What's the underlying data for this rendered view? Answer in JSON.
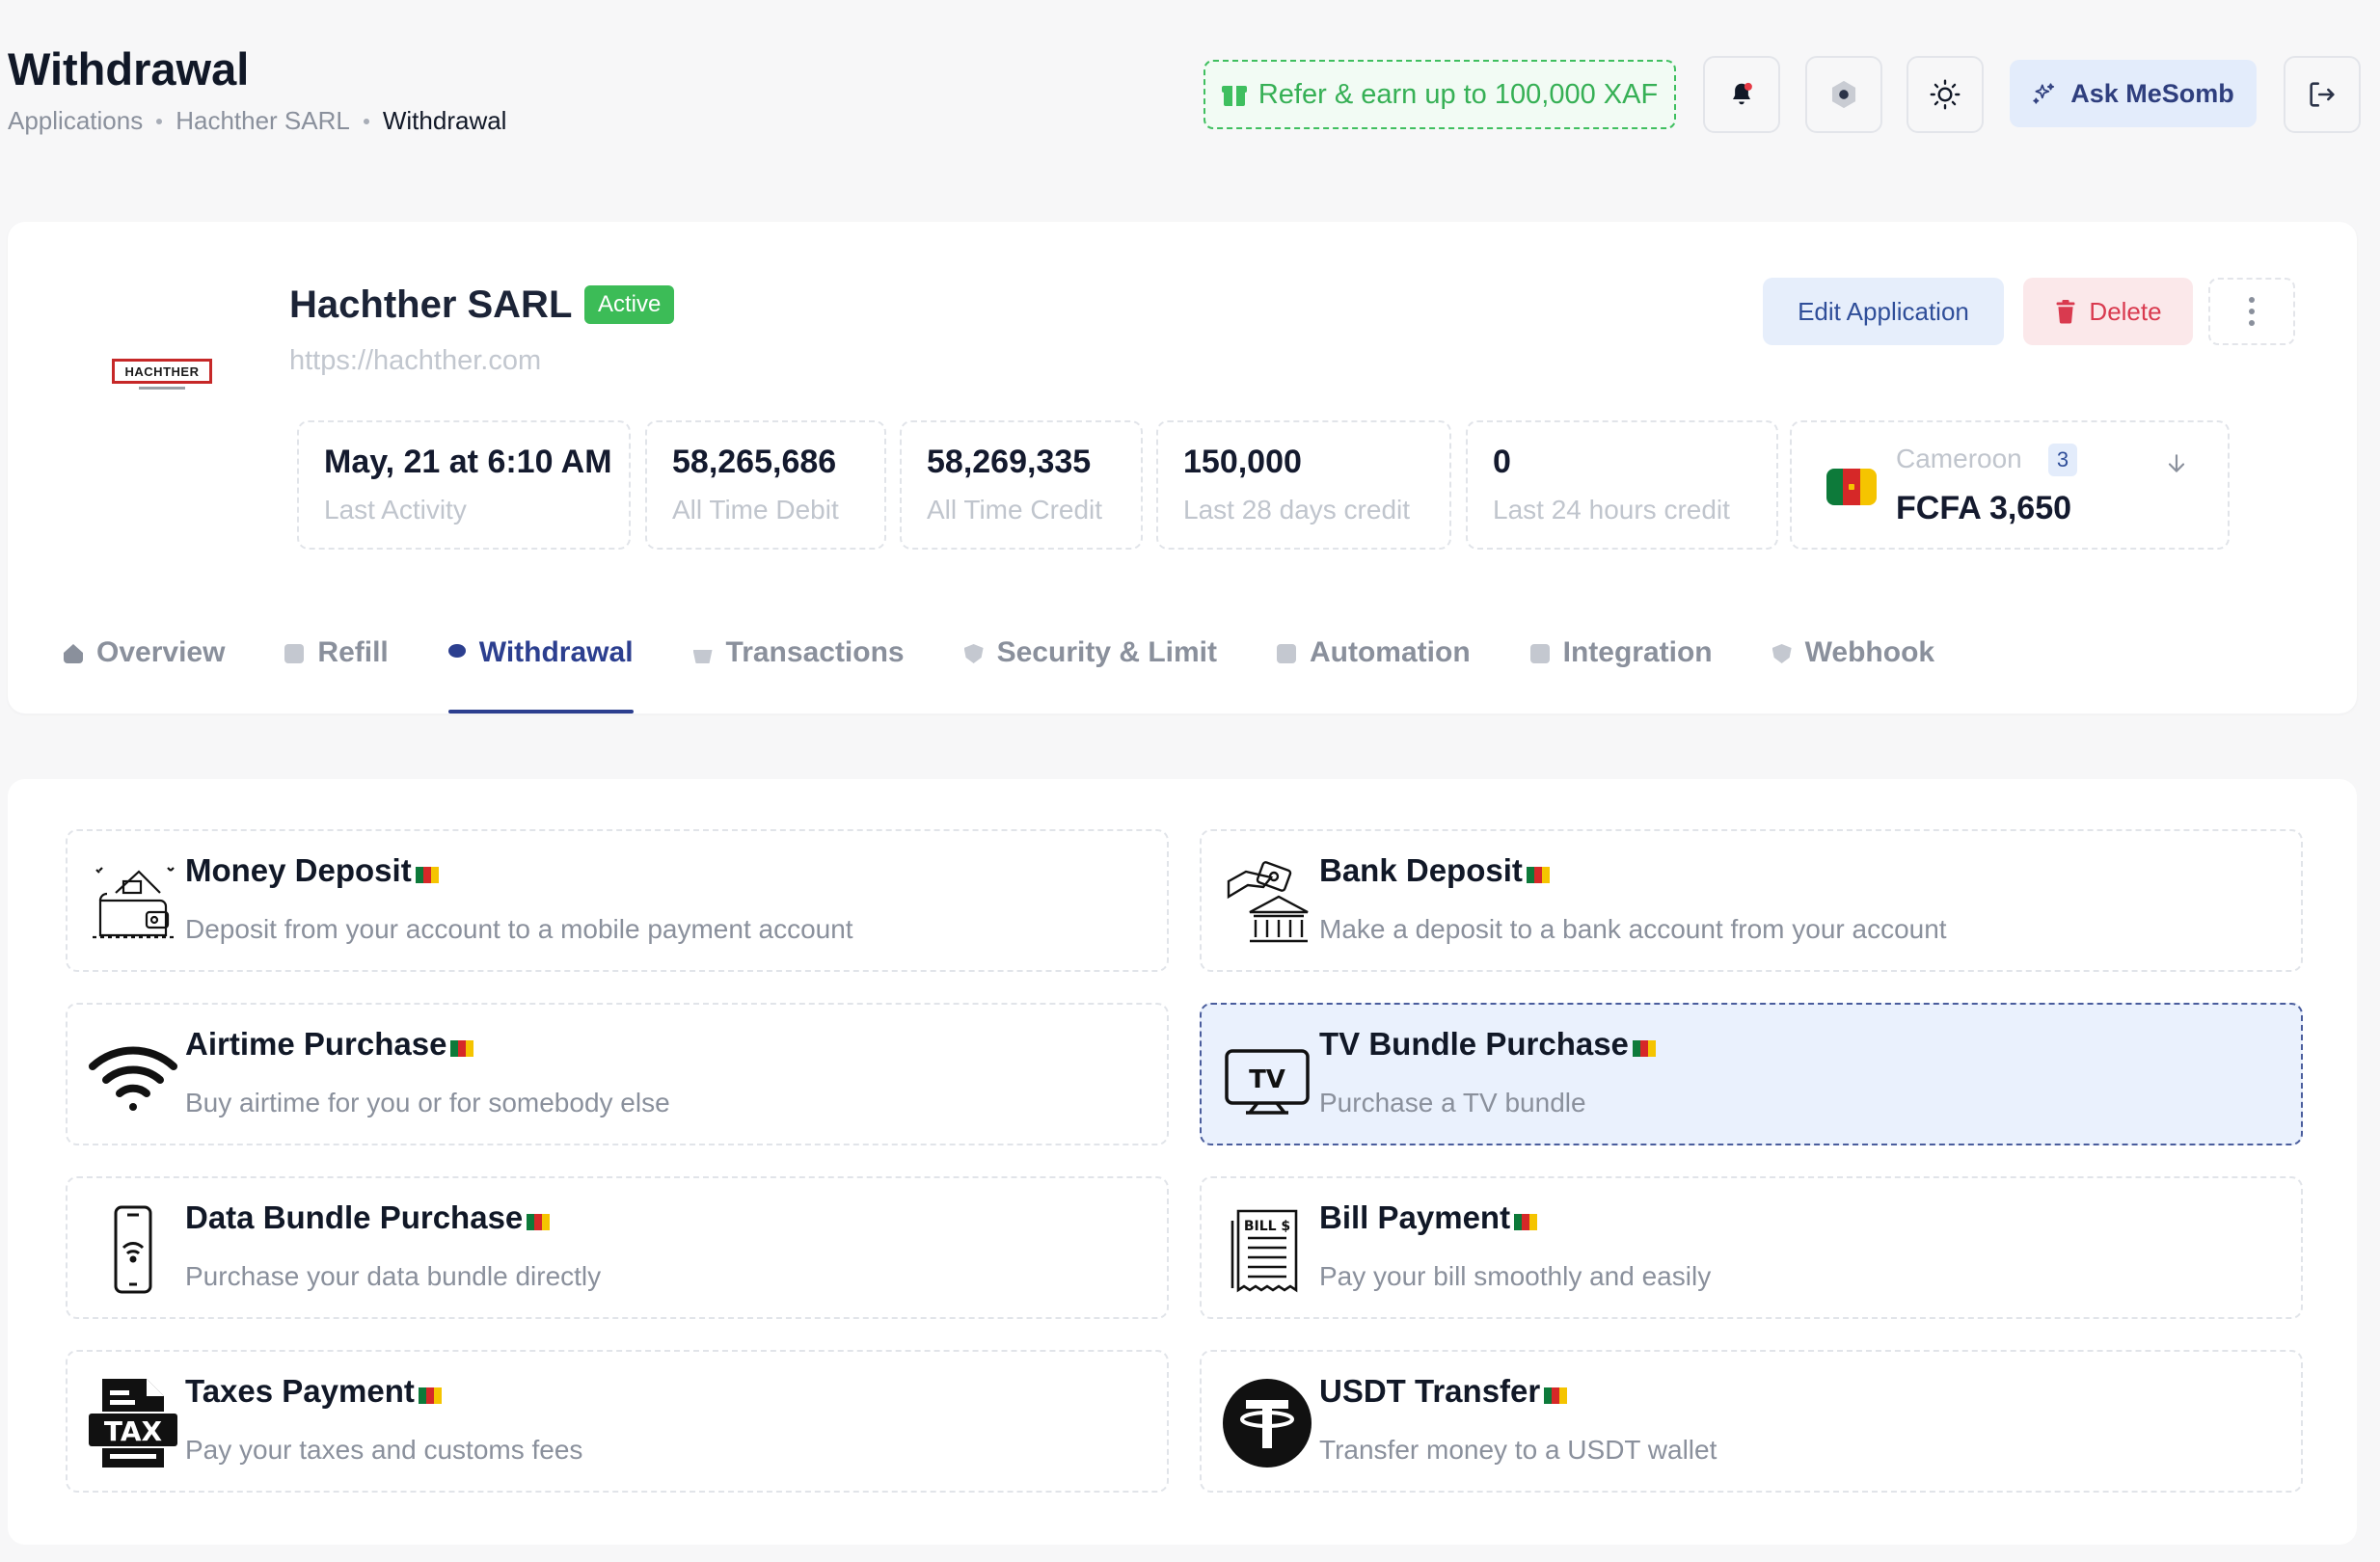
{
  "header": {
    "title": "Withdrawal",
    "breadcrumb": [
      "Applications",
      "Hachther SARL",
      "Withdrawal"
    ],
    "refer_label": "Refer & earn up to 100,000 XAF",
    "ask_label": "Ask MeSomb",
    "icons": [
      "bell-icon",
      "hexagon-icon",
      "sun-icon",
      "logout-icon"
    ]
  },
  "app": {
    "logo_text": "HACHTHER",
    "name": "Hachther SARL",
    "status": "Active",
    "url": "https://hachther.com",
    "edit_label": "Edit Application",
    "delete_label": "Delete",
    "stats": [
      {
        "value": "May, 21 at 6:10 AM",
        "label": "Last Activity"
      },
      {
        "value": "58,265,686",
        "label": "All Time Debit"
      },
      {
        "value": "58,269,335",
        "label": "All Time Credit"
      },
      {
        "value": "150,000",
        "label": "Last 28 days credit"
      },
      {
        "value": "0",
        "label": "Last 24 hours credit"
      }
    ],
    "country": {
      "name": "Cameroon",
      "count": "3",
      "amount": "FCFA 3,650"
    }
  },
  "tabs": [
    {
      "label": "Overview",
      "active": false
    },
    {
      "label": "Refill",
      "active": false
    },
    {
      "label": "Withdrawal",
      "active": true
    },
    {
      "label": "Transactions",
      "active": false
    },
    {
      "label": "Security & Limit",
      "active": false
    },
    {
      "label": "Automation",
      "active": false
    },
    {
      "label": "Integration",
      "active": false
    },
    {
      "label": "Webhook",
      "active": false
    }
  ],
  "services": [
    {
      "name": "Money Deposit",
      "desc": "Deposit from your account to a mobile payment account",
      "icon": "wallet-icon"
    },
    {
      "name": "Bank Deposit",
      "desc": "Make a deposit to a bank account from your account",
      "icon": "bank-icon"
    },
    {
      "name": "Airtime Purchase",
      "desc": "Buy airtime for you or for somebody else",
      "icon": "wifi-icon"
    },
    {
      "name": "TV Bundle Purchase",
      "desc": "Purchase a TV bundle",
      "icon": "tv-icon",
      "selected": true
    },
    {
      "name": "Data Bundle Purchase",
      "desc": "Purchase your data bundle directly",
      "icon": "phone-wifi-icon"
    },
    {
      "name": "Bill Payment",
      "desc": "Pay your bill smoothly and easily",
      "icon": "bill-icon",
      "icon_text": "BILL $"
    },
    {
      "name": "Taxes Payment",
      "desc": "Pay your taxes and customs fees",
      "icon": "tax-icon",
      "icon_text": "TAX"
    },
    {
      "name": "USDT Transfer",
      "desc": "Transfer money to a USDT wallet",
      "icon": "usdt-icon"
    }
  ],
  "colors": {
    "accent": "#2c3f8f",
    "success": "#3cbc57",
    "danger": "#d93a4f",
    "cameroon_flag": [
      "#0d7a3a",
      "#d62828",
      "#f5c400"
    ]
  }
}
